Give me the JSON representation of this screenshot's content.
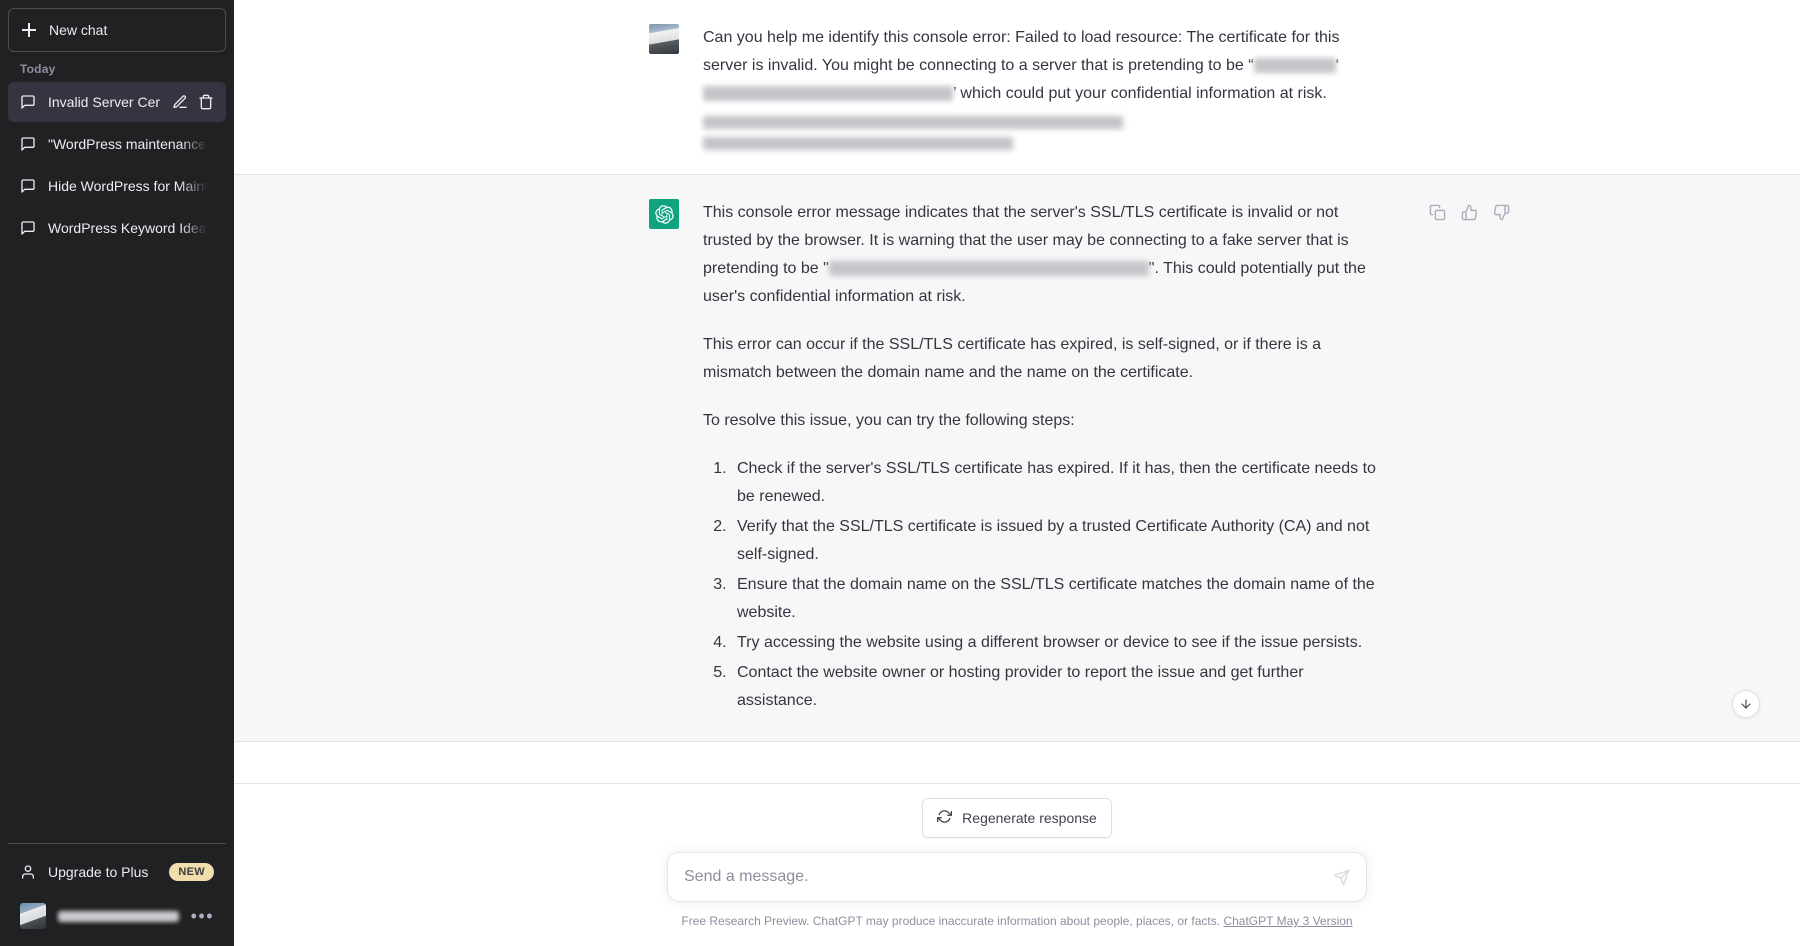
{
  "sidebar": {
    "new_chat_label": "New chat",
    "section_label": "Today",
    "chats": [
      {
        "title": "Invalid Server Certificat",
        "active": true
      },
      {
        "title": "\"WordPress maintenance plugi",
        "active": false
      },
      {
        "title": "Hide WordPress for Maintenan",
        "active": false
      },
      {
        "title": "WordPress Keyword Ideas.",
        "active": false
      }
    ],
    "upgrade_label": "Upgrade to Plus",
    "upgrade_badge": "NEW",
    "account_name_redacted": true
  },
  "conversation": {
    "user_message": {
      "text_part_1": "Can you help me identify this console error: Failed to load resource: The certificate for this server is invalid. You might be connecting to a server that is pretending to be “",
      "text_part_2": "’ which could put your confidential information at risk."
    },
    "assistant_message": {
      "paragraph_1_before": "This console error message indicates that the server's SSL/TLS certificate is invalid or not trusted by the browser. It is warning that the user may be connecting to a fake server that is pretending to be \"",
      "paragraph_1_after": "\". This could potentially put the user's confidential information at risk.",
      "paragraph_2": "This error can occur if the SSL/TLS certificate has expired, is self-signed, or if there is a mismatch between the domain name and the name on the certificate.",
      "paragraph_3": "To resolve this issue, you can try the following steps:",
      "steps": [
        "Check if the server's SSL/TLS certificate has expired. If it has, then the certificate needs to be renewed.",
        "Verify that the SSL/TLS certificate is issued by a trusted Certificate Authority (CA) and not self-signed.",
        "Ensure that the domain name on the SSL/TLS certificate matches the domain name of the website.",
        "Try accessing the website using a different browser or device to see if the issue persists.",
        "Contact the website owner or hosting provider to report the issue and get further assistance."
      ]
    }
  },
  "composer": {
    "regenerate_label": "Regenerate response",
    "input_placeholder": "Send a message.",
    "input_value": ""
  },
  "footer": {
    "disclaimer": "Free Research Preview. ChatGPT may produce inaccurate information about people, places, or facts.",
    "version_link": "ChatGPT May 3 Version"
  },
  "colors": {
    "sidebar_bg": "#202123",
    "active_chat_bg": "#343541",
    "brand_green": "#10a37f",
    "badge_yellow": "#f2deac",
    "bot_msg_bg": "#f7f7f8"
  }
}
